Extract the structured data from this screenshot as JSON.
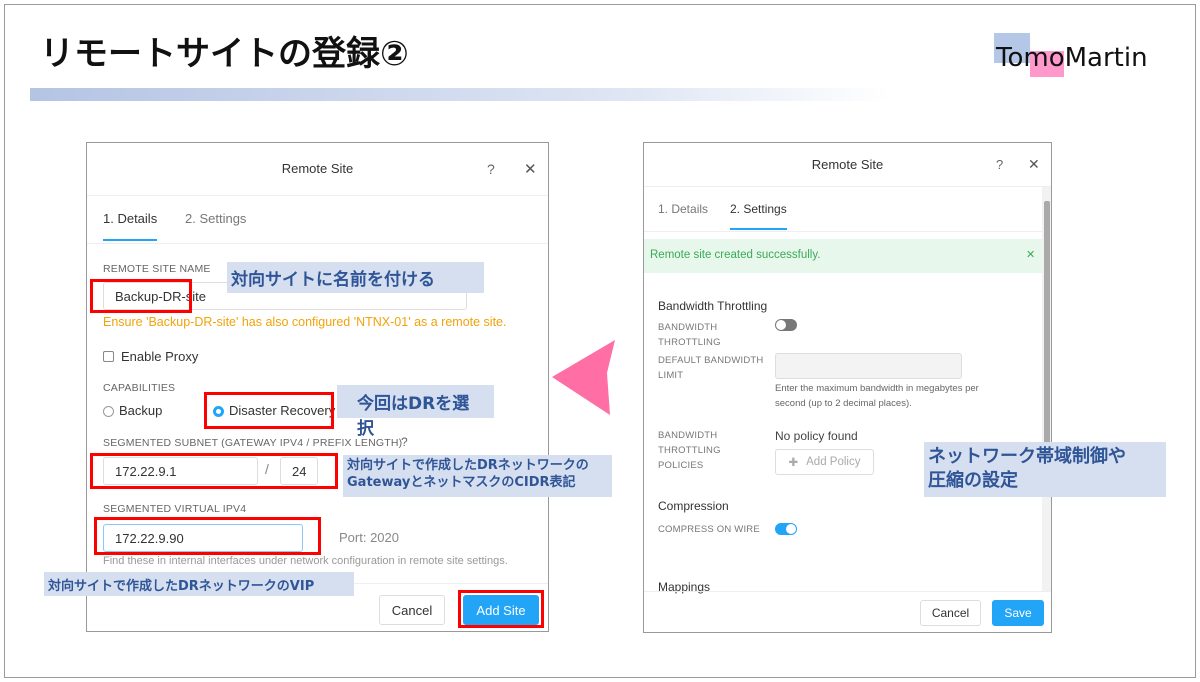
{
  "slide": {
    "title": "リモートサイトの登録②",
    "logo": "TomoMartin"
  },
  "left_dialog": {
    "title": "Remote Site",
    "help": "?",
    "close": "✕",
    "tabs": [
      {
        "label": "1. Details",
        "active": true
      },
      {
        "label": "2. Settings",
        "active": false
      }
    ],
    "remote_site_name_label": "REMOTE SITE NAME",
    "remote_site_name_value": "Backup-DR-site",
    "warning": "Ensure 'Backup-DR-site' has also configured 'NTNX-01' as a remote site.",
    "enable_proxy": "Enable Proxy",
    "capabilities_label": "CAPABILITIES",
    "cap_backup": "Backup",
    "cap_dr": "Disaster Recovery",
    "selected_capability": "Disaster Recovery",
    "subnet_label": "SEGMENTED SUBNET (GATEWAY IPV4 / PREFIX LENGTH)",
    "subnet_help": "?",
    "gateway_value": "172.22.9.1",
    "slash": "/",
    "prefix_value": "24",
    "vip_label": "SEGMENTED VIRTUAL IPV4",
    "vip_value": "172.22.9.90",
    "port": "Port: 2020",
    "hint": "Find these in internal interfaces under network configuration in remote site settings.",
    "cancel": "Cancel",
    "add_site": "Add Site"
  },
  "right_dialog": {
    "title": "Remote Site",
    "help": "?",
    "close": "✕",
    "tabs": [
      {
        "label": "1. Details",
        "active": false
      },
      {
        "label": "2. Settings",
        "active": true
      }
    ],
    "success": "Remote site created successfully.",
    "success_close": "✕",
    "bw_section": "Bandwidth Throttling",
    "bw_throttling_label": "BANDWIDTH THROTTLING",
    "bw_throttling_on": false,
    "default_bw_label": "DEFAULT BANDWIDTH LIMIT",
    "default_bw_value": "",
    "default_bw_hint": "Enter the maximum bandwidth in megabytes per second (up to 2 decimal places).",
    "policies_label": "BANDWIDTH THROTTLING POLICIES",
    "no_policy": "No policy found",
    "add_policy": "Add Policy",
    "compression_section": "Compression",
    "compress_label": "COMPRESS ON WIRE",
    "compress_on": true,
    "mappings_section": "Mappings",
    "cancel": "Cancel",
    "save": "Save"
  },
  "annotations": {
    "name": "対向サイトに名前を付ける",
    "dr": "今回はDRを選択",
    "subnet": "対向サイトで作成したDRネットワークの\nGatewayとネットマスクのCIDR表記",
    "vip": "対向サイトで作成したDRネットワークのVIP",
    "settings": "ネットワーク帯域制御や\n圧縮の設定"
  },
  "colors": {
    "accent": "#22a5f7",
    "highlight": "#ff0000",
    "annotation_bg": "#d6dff0",
    "annotation_text": "#2f5597",
    "arrow": "#ff6fa5",
    "warning": "#f0a30a",
    "success": "#3aaa55"
  }
}
